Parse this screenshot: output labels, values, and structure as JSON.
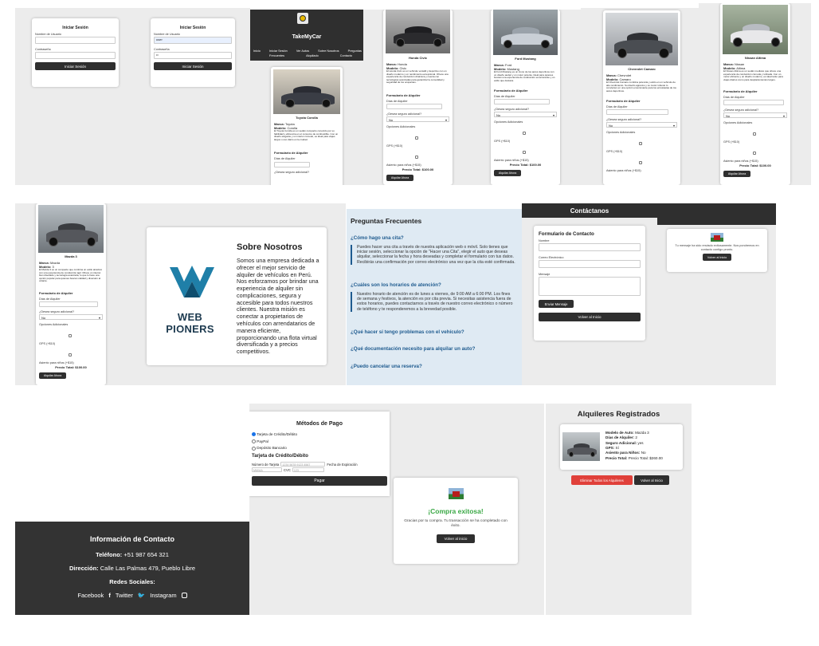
{
  "login": {
    "title": "Iniciar Sesión",
    "user_label": "Nombre de Usuario",
    "pass_label": "Contraseña",
    "button": "Iniciar Sesión",
    "user_value": "user",
    "pass_value": "••"
  },
  "home": {
    "brand": "TakeMyCar",
    "nav": [
      "Inicio",
      "Iniciar Sesión",
      "Ver Autos Frecuentes",
      "Sobre Nosotros Alquilado",
      "Preguntas Contacto"
    ],
    "nav_left": [
      "Inicio",
      "Iniciar Sesión",
      "Ver Autos",
      "Sobre Nosotros",
      "Preguntas"
    ],
    "nav_sub": [
      "Frecuentes",
      "Alquilado",
      "Contacto"
    ]
  },
  "cars": [
    {
      "name": "Toyota Corolla",
      "marca": "Toyota",
      "modelo": "Corolla",
      "desc": "El Toyota Corolla es un sedán compacto conocido por su fiabilidad y eficiencia en el consumo de combustible. Con un diseño elegante y un interior cómodo, es ideal para viajes largos o uso diario en la ciudad.",
      "color": "#3a3d45"
    },
    {
      "name": "Honda Civic",
      "marca": "Honda",
      "modelo": "Civic",
      "desc": "El Honda Civic es un vehículo versátil y deportivo con un diseño moderno y un rendimiento excepcional. Ofrece una experiencia de conducción dinámica y cuenta con tecnologías avanzadas para garantizar la comodidad y seguridad de los ocupantes.",
      "color": "#2b2b2e"
    },
    {
      "name": "Ford Mustang",
      "marca": "Ford",
      "modelo": "Mustang",
      "desc": "El Ford Mustang es un icono de los autos deportivos con un diseño audaz y un motor potente. Ideal para quienes buscan una experiencia de conducción emocionante y un estilo que destaca.",
      "color": "#c9cfd6"
    },
    {
      "name": "Chevrolet Camaro",
      "marca": "Chevrolet",
      "modelo": "Camaro",
      "desc": "El Chevrolet Camaro combina potencia y estilo en un vehículo de alto rendimiento. Su diseño agresivo y su motor robusto lo convierten en una opción emocionante para los entusiastas de los autos deportivos.",
      "color": "#4a4d52"
    },
    {
      "name": "Nissan Altima",
      "marca": "Nissan",
      "modelo": "Altima",
      "desc": "El Nissan Altima es un sedán mediano que ofrece una experiencia de conducción cómoda y refinada. Con un motor eficiente y un diseño moderno, es ideal tanto para viajes diarios como para desplazamientos largos.",
      "color": "#e8e8ea"
    },
    {
      "name": "Mazda 3",
      "marca": "Mazda",
      "modelo": "3",
      "desc": "El Mazda 3 es un compacto que combina un estilo atractivo con una experiencia de conducción ágil. Ofrece un interior bien diseñado y tecnología avanzada, lo que lo hace una opción popular para quienes buscan calidad y diversión al volante.",
      "color": "#55575c"
    }
  ],
  "rental_form": {
    "title": "Formulario de Alquiler",
    "days_label": "Días de Alquiler",
    "insurance_label": "¿Desea seguro adicional?",
    "insurance_value": "No",
    "options_label": "Opciones Adicionales",
    "gps_label": "GPS (+$10)",
    "child_label": "Asiento para niños (+$15)",
    "total": "Precio Total: $100.00",
    "button": "Alquilar Ahora",
    "labels": {
      "marca": "Marca:",
      "modelo": "Modelo:"
    }
  },
  "about": {
    "title": "Sobre Nosotros",
    "logo_text": "WEB PIONERS",
    "body": "Somos una empresa dedicada a ofrecer el mejor servicio de alquiler de vehículos en Perú. Nos esforzamos por brindar una experiencia de alquiler sin complicaciones, segura y accesible para todos nuestros clientes. Nuestra misión es conectar a propietarios de vehículos con arrendatarios de manera eficiente, proporcionando una flota virtual diversificada y a precios competitivos."
  },
  "faq": {
    "title": "Preguntas Frecuentes",
    "items": [
      {
        "q": "¿Cómo hago una cita?",
        "a": "Puedes hacer una cita a través de nuestra aplicación web o móvil. Solo tienes que iniciar sesión, seleccionar la opción de \"Hacer una Cita\", elegir el auto que deseas alquilar, seleccionar la fecha y hora deseadas y completar el formulario con tus datos. Recibirás una confirmación por correo electrónico una vez que la cita esté confirmada."
      },
      {
        "q": "¿Cuáles son los horarios de atención?",
        "a": "Nuestro horario de atención es de lunes a viernes, de 9:00 AM a 6:00 PM. Los fines de semana y festivos, la atención es por cita previa. Si necesitas asistencia fuera de estos horarios, puedes contactarnos a través de nuestro correo electrónico o número de teléfono y te responderemos a la brevedad posible."
      },
      {
        "q": "¿Qué hacer si tengo problemas con el vehículo?",
        "a": ""
      },
      {
        "q": "¿Qué documentación necesito para alquilar un auto?",
        "a": ""
      },
      {
        "q": "¿Puedo cancelar una reserva?",
        "a": ""
      }
    ]
  },
  "contact": {
    "header": "Contáctanos",
    "form_title": "Formulario de Contacto",
    "name_label": "Nombre",
    "email_label": "Correo Electrónico",
    "msg_label": "Mensaje",
    "send": "Enviar Mensaje",
    "back": "Volver al Inicio"
  },
  "sent": {
    "msg": "Tu mensaje ha sido enviado exitosamente. Nos pondremos en contacto contigo pronto.",
    "back": "Volver al Inicio"
  },
  "payment": {
    "title": "Métodos de Pago",
    "options": [
      "Tarjeta de Crédito/Débito",
      "PayPal",
      "Depósito Bancario"
    ],
    "section": "Tarjeta de Crédito/Débito",
    "card_label": "Número de Tarjeta",
    "card_placeholder": "1234 5678 9123 4567",
    "exp_label": "Fecha de Expiración",
    "exp_placeholder": "MM/AA",
    "cvc_label": "CVC",
    "cvc_placeholder": "123",
    "button": "Pagar"
  },
  "success": {
    "title": "¡Compra exitosa!",
    "msg": "Gracias por tu compra. Tu transacción se ha completado con éxito.",
    "button": "Volver al inicio"
  },
  "rentals": {
    "title": "Alquileres Registrados",
    "fields": [
      {
        "k": "Modelo de Auto:",
        "v": "Mazda 3"
      },
      {
        "k": "Días de Alquiler:",
        "v": "2"
      },
      {
        "k": "Seguro Adicional:",
        "v": "yes"
      },
      {
        "k": "GPS:",
        "v": "Sí"
      },
      {
        "k": "Asiento para Niños:",
        "v": "No"
      },
      {
        "k": "Precio Total:",
        "v": "Precio Total: $260.00"
      }
    ],
    "delete": "Eliminar Todos los Alquileres",
    "back": "Volver al Inicio"
  },
  "footer": {
    "title": "Información de Contacto",
    "phone_k": "Teléfono:",
    "phone_v": "+51 987 654 321",
    "addr_k": "Dirección:",
    "addr_v": "Calle Las Palmas 479, Pueblo Libre",
    "social_title": "Redes Sociales:",
    "social": [
      "Facebook",
      "Twitter",
      "Instagram"
    ]
  },
  "colors": {
    "dark": "#2f2f2f",
    "accent_link": "#1f5b8f",
    "success_green": "#3aa845",
    "danger": "#e0403a",
    "faq_bg": "#dfeaf3"
  }
}
